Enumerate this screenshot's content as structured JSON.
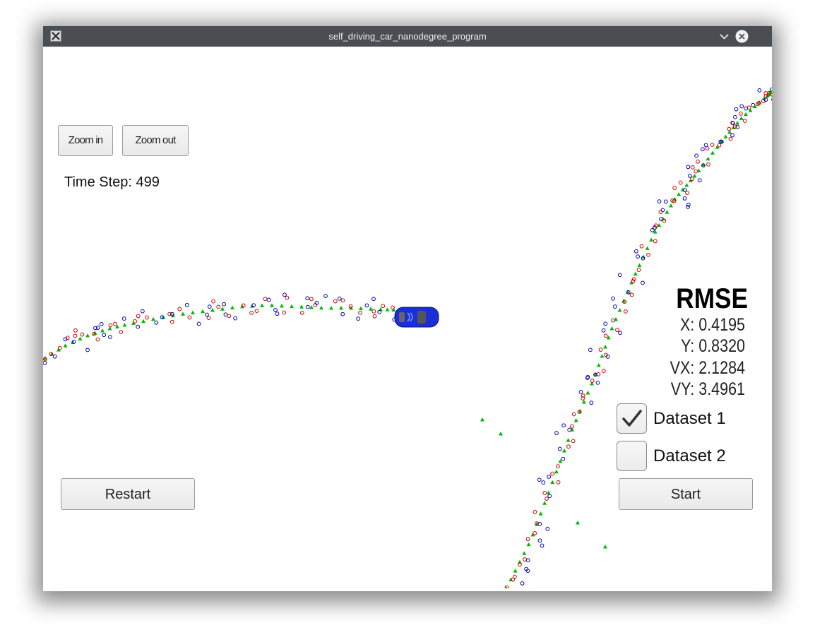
{
  "window": {
    "title": "self_driving_car_nanodegree_program",
    "app_icon": "x-window-icon",
    "controls": [
      "chevron-down-icon",
      "close-icon"
    ]
  },
  "controls": {
    "zoom_in_label": "Zoom in",
    "zoom_out_label": "Zoom out",
    "restart_label": "Restart",
    "start_label": "Start"
  },
  "status": {
    "time_step_label": "Time Step: 499"
  },
  "rmse": {
    "title": "RMSE",
    "x": "X: 0.4195",
    "y": "Y: 0.8320",
    "vx": "VX: 2.1284",
    "vy": "VY: 3.4961"
  },
  "datasets": [
    {
      "label": "Dataset 1",
      "checked": true
    },
    {
      "label": "Dataset 2",
      "checked": false
    }
  ],
  "legend_colors": {
    "lidar": "#cc0000",
    "radar": "#0000bb",
    "estimate": "#00bb00",
    "car": "#1a2fd8"
  }
}
